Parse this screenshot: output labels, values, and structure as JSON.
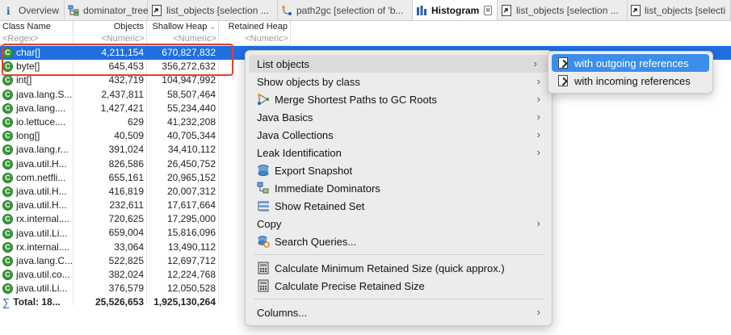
{
  "tabs": [
    {
      "label": "Overview",
      "icon": "info-icon"
    },
    {
      "label": "dominator_tree",
      "icon": "tree-icon"
    },
    {
      "label": "list_objects  [selection ...",
      "icon": "list-icon"
    },
    {
      "label": "path2gc  [selection of 'b...",
      "icon": "path-icon"
    },
    {
      "label": "Histogram",
      "icon": "histogram-icon",
      "active": true
    },
    {
      "label": "list_objects  [selection ...",
      "icon": "list-icon"
    },
    {
      "label": "list_objects  [selecti",
      "icon": "list-icon"
    }
  ],
  "columns": {
    "class_name": "Class Name",
    "objects": "Objects",
    "shallow": "Shallow Heap",
    "retained": "Retained Heap"
  },
  "filters": {
    "class_name": "<Regex>",
    "objects": "<Numeric>",
    "shallow": "<Numeric>",
    "retained": "<Numeric>"
  },
  "rows": [
    {
      "name": "char[]",
      "objects": "4,211,154",
      "shallow": "670,827,832"
    },
    {
      "name": "byte[]",
      "objects": "645,453",
      "shallow": "356,272,632"
    },
    {
      "name": "int[]",
      "objects": "432,719",
      "shallow": "104,947,992"
    },
    {
      "name": "java.lang.S...",
      "objects": "2,437,811",
      "shallow": "58,507,464"
    },
    {
      "name": "java.lang....",
      "objects": "1,427,421",
      "shallow": "55,234,440"
    },
    {
      "name": "io.lettuce....",
      "objects": "629",
      "shallow": "41,232,208"
    },
    {
      "name": "long[]",
      "objects": "40,509",
      "shallow": "40,705,344"
    },
    {
      "name": "java.lang.r...",
      "objects": "391,024",
      "shallow": "34,410,112"
    },
    {
      "name": "java.util.H...",
      "objects": "826,586",
      "shallow": "26,450,752"
    },
    {
      "name": "com.netfli...",
      "objects": "655,161",
      "shallow": "20,965,152"
    },
    {
      "name": "java.util.H...",
      "objects": "416,819",
      "shallow": "20,007,312"
    },
    {
      "name": "java.util.H...",
      "objects": "232,611",
      "shallow": "17,617,664"
    },
    {
      "name": "rx.internal....",
      "objects": "720,625",
      "shallow": "17,295,000"
    },
    {
      "name": "java.util.Li...",
      "objects": "659,004",
      "shallow": "15,816,096"
    },
    {
      "name": "rx.internal....",
      "objects": "33,064",
      "shallow": "13,490,112"
    },
    {
      "name": "java.lang.C...",
      "objects": "522,825",
      "shallow": "12,697,712"
    },
    {
      "name": "java.util.co...",
      "objects": "382,024",
      "shallow": "12,224,768"
    },
    {
      "name": "java.util.Li...",
      "objects": "376,579",
      "shallow": "12,050,528"
    }
  ],
  "total": {
    "name": "Total: 18...",
    "objects": "25,526,653",
    "shallow": "1,925,130,264"
  },
  "menu": {
    "items": [
      {
        "label": "List objects",
        "submenu": true,
        "icon": ""
      },
      {
        "label": "Show objects by class",
        "submenu": true,
        "icon": ""
      },
      {
        "label": "Merge Shortest Paths to GC Roots",
        "submenu": true,
        "icon": "merge-paths-icon"
      },
      {
        "label": "Java Basics",
        "submenu": true,
        "icon": ""
      },
      {
        "label": "Java Collections",
        "submenu": true,
        "icon": ""
      },
      {
        "label": "Leak Identification",
        "submenu": true,
        "icon": ""
      },
      {
        "label": "Export Snapshot",
        "submenu": false,
        "icon": "export-snapshot-icon"
      },
      {
        "label": "Immediate Dominators",
        "submenu": false,
        "icon": "dominators-icon"
      },
      {
        "label": "Show Retained Set",
        "submenu": false,
        "icon": "retained-set-icon"
      },
      {
        "label": "Copy",
        "submenu": true,
        "icon": ""
      },
      {
        "label": "Search Queries...",
        "submenu": false,
        "icon": "search-queries-icon"
      },
      {
        "label": "Calculate Minimum Retained Size (quick approx.)",
        "submenu": false,
        "icon": "calculator-icon"
      },
      {
        "label": "Calculate Precise Retained Size",
        "submenu": false,
        "icon": "calculator-icon"
      },
      {
        "label": "Columns...",
        "submenu": true,
        "icon": ""
      }
    ],
    "submenu": [
      {
        "label": "with outgoing references",
        "active": true
      },
      {
        "label": "with incoming references",
        "active": false
      }
    ]
  },
  "colors": {
    "selection": "#1f6fe0",
    "highlight_border": "#e0412f",
    "submenu_active": "#3b8eea"
  }
}
